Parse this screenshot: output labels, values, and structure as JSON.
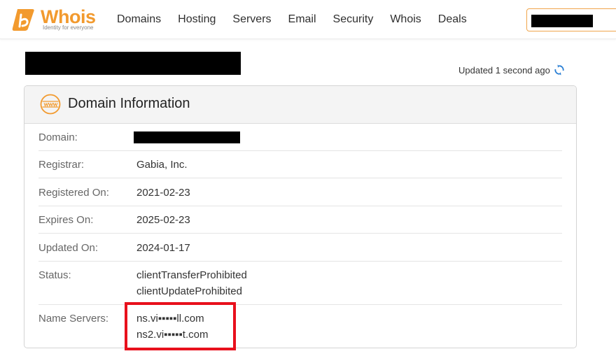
{
  "brand": {
    "name": "Whois",
    "tagline": "Identity for everyone",
    "color": "#f29a2e"
  },
  "nav": {
    "items": [
      {
        "label": "Domains"
      },
      {
        "label": "Hosting"
      },
      {
        "label": "Servers"
      },
      {
        "label": "Email"
      },
      {
        "label": "Security"
      },
      {
        "label": "Whois"
      },
      {
        "label": "Deals"
      }
    ]
  },
  "search": {
    "value": "",
    "redacted": true
  },
  "page": {
    "domain_title_redacted": true,
    "updated_text": "Updated 1 second ago"
  },
  "card": {
    "title": "Domain Information",
    "icon": "www-icon",
    "rows": [
      {
        "label": "Domain:",
        "value": "",
        "redacted": true
      },
      {
        "label": "Registrar:",
        "value": "Gabia, Inc."
      },
      {
        "label": "Registered On:",
        "value": "2021-02-23"
      },
      {
        "label": "Expires On:",
        "value": "2025-02-23"
      },
      {
        "label": "Updated On:",
        "value": "2024-01-17"
      },
      {
        "label": "Status:",
        "values": [
          "clientTransferProhibited",
          "clientUpdateProhibited"
        ]
      },
      {
        "label": "Name Servers:",
        "values": [
          "ns.vi▪▪▪▪▪ll.com",
          "ns2.vi▪▪▪▪▪t.com"
        ]
      }
    ]
  },
  "colors": {
    "accent": "#f29a2e",
    "highlight": "#e8101c",
    "refresh": "#2a7fd4"
  }
}
